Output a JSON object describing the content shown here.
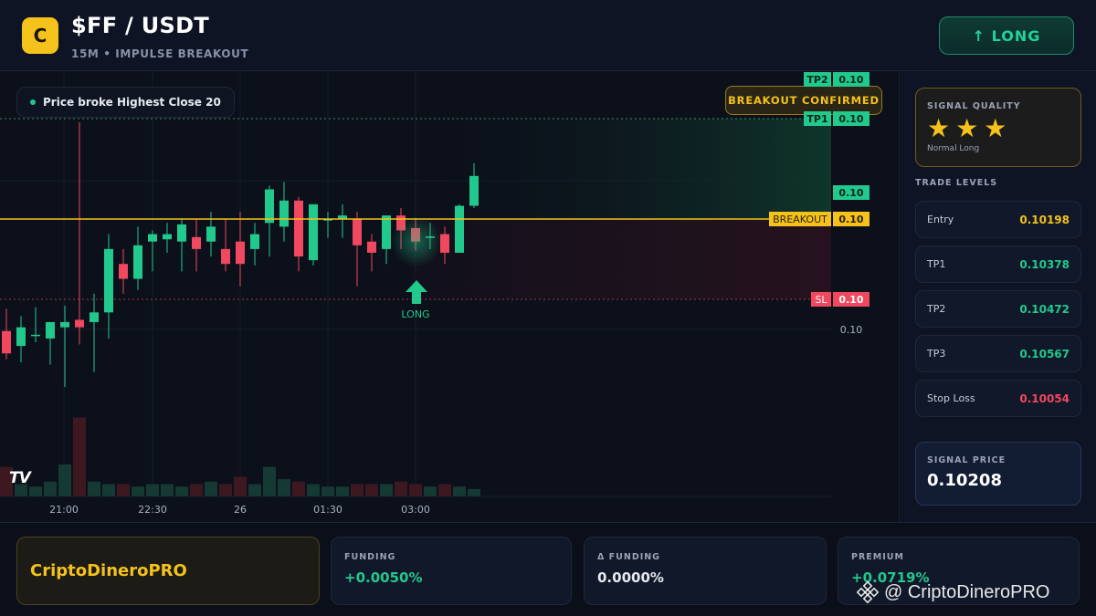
{
  "header": {
    "logo_letter": "C",
    "title": "$FF / USDT",
    "subtitle": "15M • IMPULSE BREAKOUT",
    "direction_button": "↑ LONG"
  },
  "chart": {
    "info_text": "Price broke Highest Close 20",
    "breakout_badge": "BREAKOUT CONFIRMED",
    "signal_label": "LONG",
    "tv_logo": "TV",
    "time_ticks": [
      "21:00",
      "22:30",
      "26",
      "01:30",
      "03:00"
    ],
    "price_tags": {
      "tp2_label": "TP2",
      "tp2_value": "0.10",
      "tp1_label": "TP1",
      "tp1_value": "0.10",
      "current_value": "0.10",
      "breakout_label": "BREAKOUT",
      "breakout_value": "0.10",
      "sl_label": "SL",
      "sl_value": "0.10",
      "axis_value": "0.10"
    },
    "colors": {
      "up": "#22c98c",
      "down": "#f0485e",
      "breakout": "#f4c21b"
    },
    "candles": [
      {
        "o": 0.1004,
        "h": 0.1007,
        "l": 0.10002,
        "c": 0.1001
      },
      {
        "o": 0.1002,
        "h": 0.1006,
        "l": 0.09998,
        "c": 0.10045
      },
      {
        "o": 0.10035,
        "h": 0.10072,
        "l": 0.10025,
        "c": 0.10035
      },
      {
        "o": 0.1003,
        "h": 0.1005,
        "l": 0.09995,
        "c": 0.10052
      },
      {
        "o": 0.10045,
        "h": 0.10074,
        "l": 0.09965,
        "c": 0.10052
      },
      {
        "o": 0.10055,
        "h": 0.1032,
        "l": 0.10022,
        "c": 0.10045
      },
      {
        "o": 0.10052,
        "h": 0.1009,
        "l": 0.09985,
        "c": 0.10065
      },
      {
        "o": 0.10065,
        "h": 0.1017,
        "l": 0.1003,
        "c": 0.1015
      },
      {
        "o": 0.1013,
        "h": 0.1015,
        "l": 0.1009,
        "c": 0.1011
      },
      {
        "o": 0.1011,
        "h": 0.1018,
        "l": 0.10095,
        "c": 0.10155
      },
      {
        "o": 0.1016,
        "h": 0.10175,
        "l": 0.1012,
        "c": 0.1017
      },
      {
        "o": 0.10163,
        "h": 0.10185,
        "l": 0.10145,
        "c": 0.1017
      },
      {
        "o": 0.1016,
        "h": 0.1019,
        "l": 0.1012,
        "c": 0.10183
      },
      {
        "o": 0.10166,
        "h": 0.1019,
        "l": 0.1012,
        "c": 0.1015
      },
      {
        "o": 0.1016,
        "h": 0.102,
        "l": 0.1014,
        "c": 0.1018
      },
      {
        "o": 0.1015,
        "h": 0.1019,
        "l": 0.1012,
        "c": 0.1013
      },
      {
        "o": 0.1016,
        "h": 0.102,
        "l": 0.101,
        "c": 0.1013
      },
      {
        "o": 0.1015,
        "h": 0.10185,
        "l": 0.10128,
        "c": 0.1017
      },
      {
        "o": 0.10185,
        "h": 0.10235,
        "l": 0.1014,
        "c": 0.1023
      },
      {
        "o": 0.1018,
        "h": 0.1024,
        "l": 0.1016,
        "c": 0.10215
      },
      {
        "o": 0.10215,
        "h": 0.1022,
        "l": 0.1012,
        "c": 0.1014
      },
      {
        "o": 0.10135,
        "h": 0.10195,
        "l": 0.10128,
        "c": 0.1021
      },
      {
        "o": 0.1019,
        "h": 0.102,
        "l": 0.10165,
        "c": 0.1019
      },
      {
        "o": 0.1019,
        "h": 0.1021,
        "l": 0.10165,
        "c": 0.10195
      },
      {
        "o": 0.1019,
        "h": 0.102,
        "l": 0.101,
        "c": 0.10155
      },
      {
        "o": 0.1016,
        "h": 0.1017,
        "l": 0.1012,
        "c": 0.10145
      },
      {
        "o": 0.1015,
        "h": 0.1018,
        "l": 0.1013,
        "c": 0.10195
      },
      {
        "o": 0.10195,
        "h": 0.10205,
        "l": 0.1015,
        "c": 0.10175
      },
      {
        "o": 0.10178,
        "h": 0.10192,
        "l": 0.10148,
        "c": 0.1016
      },
      {
        "o": 0.10165,
        "h": 0.10185,
        "l": 0.1015,
        "c": 0.10167
      },
      {
        "o": 0.1017,
        "h": 0.1018,
        "l": 0.1013,
        "c": 0.10145
      },
      {
        "o": 0.10145,
        "h": 0.1021,
        "l": 0.10145,
        "c": 0.10208
      },
      {
        "o": 0.10208,
        "h": 0.10265,
        "l": 0.10205,
        "c": 0.10248
      }
    ],
    "volumes": [
      0.12,
      0.05,
      0.04,
      0.06,
      0.13,
      0.32,
      0.06,
      0.05,
      0.05,
      0.04,
      0.05,
      0.05,
      0.04,
      0.05,
      0.06,
      0.05,
      0.08,
      0.05,
      0.12,
      0.07,
      0.06,
      0.05,
      0.04,
      0.04,
      0.05,
      0.05,
      0.05,
      0.06,
      0.05,
      0.04,
      0.05,
      0.04,
      0.03
    ],
    "levels": {
      "tp2": 0.10315,
      "tp1": 0.10292,
      "breakout": 0.10198,
      "sl": 0.10112,
      "axis": 0.1008,
      "current": 0.1021
    }
  },
  "signal_quality": {
    "label": "SIGNAL QUALITY",
    "stars": [
      "★",
      "★",
      "★"
    ],
    "note": "Normal Long"
  },
  "trade_levels": {
    "label": "TRADE LEVELS",
    "rows": [
      {
        "name": "Entry",
        "value": "0.10198",
        "color": "#f4c21b"
      },
      {
        "name": "TP1",
        "value": "0.10378",
        "color": "#22c98c"
      },
      {
        "name": "TP2",
        "value": "0.10472",
        "color": "#22c98c"
      },
      {
        "name": "TP3",
        "value": "0.10567",
        "color": "#22c98c"
      },
      {
        "name": "Stop Loss",
        "value": "0.10054",
        "color": "#f0485e"
      }
    ]
  },
  "signal_price": {
    "label": "SIGNAL PRICE",
    "value": "0.10208"
  },
  "footer": {
    "brand": "CriptoDineroPRO",
    "funding": {
      "label": "FUNDING",
      "value": "+0.0050%"
    },
    "delta_funding": {
      "label": "Δ FUNDING",
      "value": "0.0000%"
    },
    "premium": {
      "label": "PREMIUM",
      "value": "+0.0719%"
    },
    "watermark": "@ CriptoDineroPRO"
  }
}
